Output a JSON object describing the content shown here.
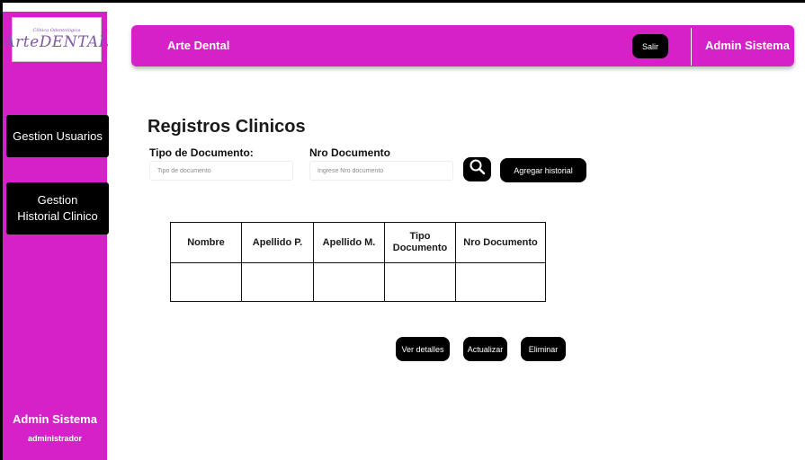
{
  "sidebar": {
    "logo_small": "Clínica Odontológica",
    "logo_main": "ArteDENTAL",
    "items": [
      {
        "label": "Gestion Usuarios"
      },
      {
        "label": "Gestion Historial Clinico"
      }
    ],
    "user_name": "Admin Sistema",
    "user_role": "administrador"
  },
  "header": {
    "title": "Arte Dental",
    "logout_label": "Salir",
    "user_name": "Admin Sistema"
  },
  "main": {
    "title": "Registros Clinicos",
    "doc_type_label": "Tipo de Documento:",
    "doc_type_placeholder": "Tipo de documento",
    "doc_number_label": "Nro Documento",
    "doc_number_placeholder": "Ingrese Nro documento",
    "search_icon": "search-icon",
    "add_button": "Agregar historial"
  },
  "table": {
    "headers": [
      "Nombre",
      "Apellido P.",
      "Apellido M.",
      "Tipo Documento",
      "Nro Documento"
    ],
    "rows": [
      [
        "",
        "",
        "",
        "",
        ""
      ]
    ]
  },
  "actions": {
    "details": "Ver detalles",
    "update": "Actualizar",
    "delete": "Eliminar"
  },
  "colors": {
    "accent": "#d620c8",
    "button": "#000000"
  }
}
